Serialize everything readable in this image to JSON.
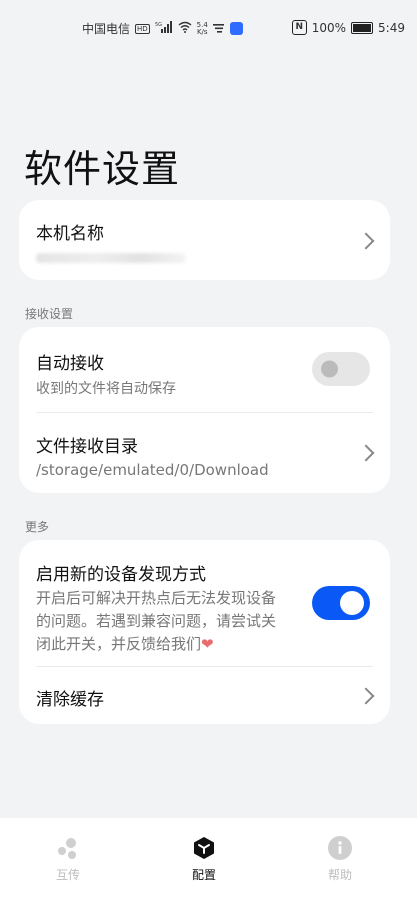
{
  "status_bar": {
    "carrier": "中国电信",
    "hd": "HD",
    "net_type": "5G",
    "speed_value": "5.4",
    "speed_unit": "K/s",
    "battery": "100%",
    "time": "5:49"
  },
  "page_title": "软件设置",
  "device": {
    "title": "本机名称"
  },
  "receive_section": {
    "label": "接收设置",
    "auto_receive": {
      "title": "自动接收",
      "subtitle": "收到的文件将自动保存",
      "enabled": false
    },
    "directory": {
      "title": "文件接收目录",
      "path": "/storage/emulated/0/Download"
    }
  },
  "more_section": {
    "label": "更多",
    "discovery": {
      "title": "启用新的设备发现方式",
      "desc_line1": "开启后可解决开热点后无法发现设备",
      "desc_line2": "的问题。若遇到兼容问题，请尝试关",
      "desc_line3": "闭此开关，并反馈给我们",
      "heart": "❤",
      "enabled": true
    },
    "clear_cache": {
      "title": "清除缓存"
    }
  },
  "tabs": [
    {
      "label": "互传",
      "icon": "transfer-icon",
      "active": false
    },
    {
      "label": "配置",
      "icon": "config-icon",
      "active": true
    },
    {
      "label": "帮助",
      "icon": "help-icon",
      "active": false
    }
  ],
  "colors": {
    "accent": "#0a59f7",
    "background": "#f1f3f5",
    "card": "#ffffff"
  }
}
